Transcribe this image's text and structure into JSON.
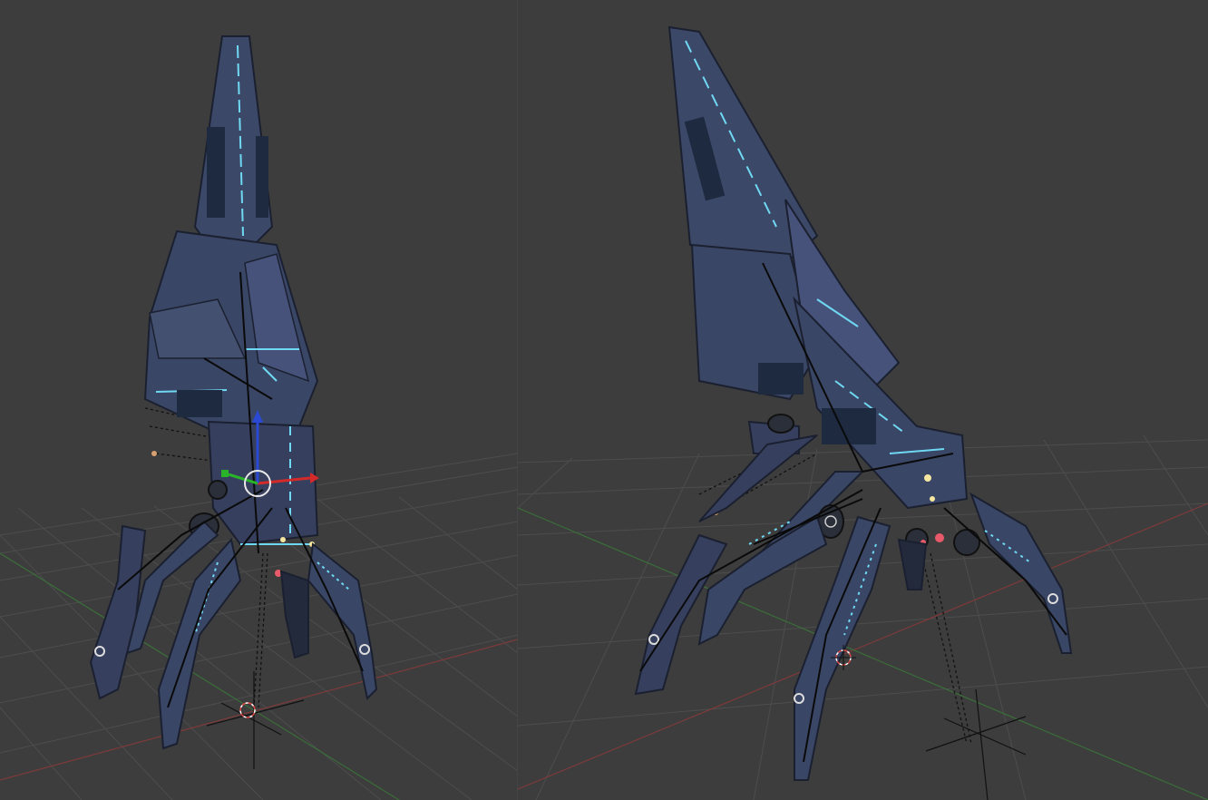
{
  "app": {
    "type": "3d-viewport",
    "background": "#3d3d3d"
  },
  "viewports": [
    {
      "name": "left-viewport",
      "subject": "robotic-squid-model",
      "grid_color": "#4a4a4a",
      "x_axis_color": "#8a3a3a",
      "y_axis_color": "#3d7a3d",
      "gizmo": {
        "x_color": "#d42a2a",
        "y_color": "#2ab42a",
        "z_color": "#2a4ad4"
      }
    },
    {
      "name": "right-viewport",
      "subject": "robotic-squid-model",
      "grid_color": "#4a4a4a",
      "x_axis_color": "#8a3a3a",
      "y_axis_color": "#3d7a3d"
    }
  ],
  "model": {
    "hull_color": "#3c4868",
    "hull_dark": "#232a3c",
    "glow_color": "#6fd8f2",
    "light_color": "#f5e6a0",
    "eye_color": "#e85a6a"
  }
}
